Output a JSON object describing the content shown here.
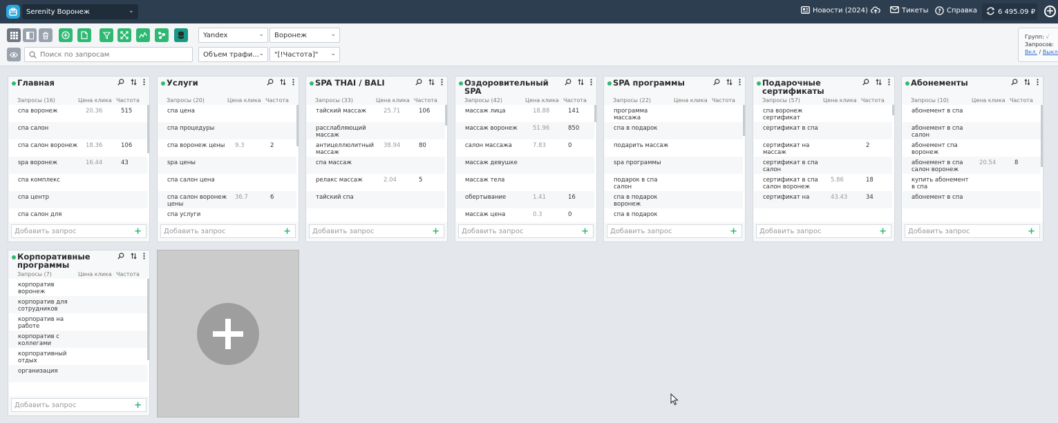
{
  "topbar": {
    "project": "Serenity Воронеж",
    "news": "Новости (2024)",
    "tickets": "Тикеты",
    "help": "Справка",
    "balance": "6 495.09 ₽"
  },
  "toolbar": {
    "search_placeholder": "Поиск по запросам",
    "engine": "Yandex",
    "region": "Воронеж",
    "traffic": "Объем трафи...",
    "frequency": "\"[!Частота]\"",
    "info_groups": "Групп: ",
    "info_queries": "Запросов: ",
    "info_on": "Вкл.",
    "info_sep": " / ",
    "info_off": "Выкл."
  },
  "columns": {
    "price": "Цена клика",
    "freq": "Частота"
  },
  "add_placeholder": "Добавить запрос",
  "groups": [
    {
      "title": "Главная",
      "count": "Запросы (16)",
      "rows": [
        {
          "q": "спа воронеж",
          "p": "20.36",
          "f": "515"
        },
        {
          "q": "спа салон",
          "p": "",
          "f": ""
        },
        {
          "q": "спа салон воронеж",
          "p": "18.36",
          "f": "106"
        },
        {
          "q": "spa воронеж",
          "p": "16.44",
          "f": "43"
        },
        {
          "q": "спа комплекс",
          "p": "",
          "f": ""
        },
        {
          "q": "спа центр",
          "p": "",
          "f": ""
        },
        {
          "q": "спа салон для",
          "p": "",
          "f": ""
        }
      ]
    },
    {
      "title": "Услуги",
      "count": "Запросы (20)",
      "rows": [
        {
          "q": "спа цена",
          "p": "",
          "f": ""
        },
        {
          "q": "спа процедуры",
          "p": "",
          "f": ""
        },
        {
          "q": "спа воронеж цены",
          "p": "9.3",
          "f": "2"
        },
        {
          "q": "spa цены",
          "p": "",
          "f": ""
        },
        {
          "q": "спа салон цена",
          "p": "",
          "f": ""
        },
        {
          "q": "спа салон воронеж цены",
          "p": "36.7",
          "f": "6"
        },
        {
          "q": "спа услуги",
          "p": "",
          "f": ""
        }
      ]
    },
    {
      "title": "SPA THAI / BALI",
      "count": "Запросы (33)",
      "rows": [
        {
          "q": "тайский массаж",
          "p": "25.71",
          "f": "106"
        },
        {
          "q": "расслабляющий массаж",
          "p": "",
          "f": ""
        },
        {
          "q": "антицеллюлитный массаж",
          "p": "38.94",
          "f": "80"
        },
        {
          "q": "спа массаж",
          "p": "",
          "f": ""
        },
        {
          "q": "релакс массаж",
          "p": "2.04",
          "f": "5"
        },
        {
          "q": "тайский спа",
          "p": "",
          "f": ""
        }
      ]
    },
    {
      "title": "Оздоровительный SPA",
      "count": "Запросы (42)",
      "rows": [
        {
          "q": "массаж лица",
          "p": "18.88",
          "f": "141"
        },
        {
          "q": "массаж воронеж",
          "p": "51.96",
          "f": "850"
        },
        {
          "q": "салон массажа",
          "p": "7.83",
          "f": "0"
        },
        {
          "q": "массаж девушке",
          "p": "",
          "f": ""
        },
        {
          "q": "массаж тела",
          "p": "",
          "f": ""
        },
        {
          "q": "обертывание",
          "p": "1.41",
          "f": "16"
        },
        {
          "q": "массаж цена",
          "p": "0.3",
          "f": "0"
        }
      ]
    },
    {
      "title": "SPA программы",
      "count": "Запросы (22)",
      "rows": [
        {
          "q": "программа массажа",
          "p": "",
          "f": ""
        },
        {
          "q": "спа в подарок",
          "p": "",
          "f": ""
        },
        {
          "q": "подарить массаж",
          "p": "",
          "f": ""
        },
        {
          "q": "spa программы",
          "p": "",
          "f": ""
        },
        {
          "q": "подарок в спа салон",
          "p": "",
          "f": ""
        },
        {
          "q": "спа в подарок воронеж",
          "p": "",
          "f": ""
        },
        {
          "q": "спа в подарок",
          "p": "",
          "f": ""
        }
      ]
    },
    {
      "title": "Подарочные сертификаты",
      "count": "Запросы (57)",
      "rows": [
        {
          "q": "спа воронеж сертификат",
          "p": "",
          "f": ""
        },
        {
          "q": "сертификат в спа",
          "p": "",
          "f": ""
        },
        {
          "q": "сертификат на массаж",
          "p": "",
          "f": "2"
        },
        {
          "q": "сертификат в спа салон",
          "p": "",
          "f": ""
        },
        {
          "q": "сертификат в спа салон воронеж",
          "p": "5.86",
          "f": "18"
        },
        {
          "q": "сертификат на",
          "p": "43.43",
          "f": "34"
        }
      ]
    },
    {
      "title": "Абонементы",
      "count": "Запросы (10)",
      "rows": [
        {
          "q": "абонемент в спа",
          "p": "",
          "f": ""
        },
        {
          "q": "абонемент в спа салон",
          "p": "",
          "f": ""
        },
        {
          "q": "абонемент спа воронеж",
          "p": "",
          "f": ""
        },
        {
          "q": "абонемент в спа салон воронеж",
          "p": "20.54",
          "f": "8"
        },
        {
          "q": "купить абонемент в спа",
          "p": "",
          "f": ""
        },
        {
          "q": "абонемент в спа",
          "p": "",
          "f": ""
        }
      ]
    },
    {
      "title": "Корпоративные программы",
      "count": "Запросы (7)",
      "rows": [
        {
          "q": "корпоратив воронеж",
          "p": "",
          "f": ""
        },
        {
          "q": "корпоратив для сотрудников",
          "p": "",
          "f": ""
        },
        {
          "q": "корпоратив на работе",
          "p": "",
          "f": ""
        },
        {
          "q": "корпоратив с коллегами",
          "p": "",
          "f": ""
        },
        {
          "q": "корпоративный отдых",
          "p": "",
          "f": ""
        },
        {
          "q": "организация",
          "p": "",
          "f": ""
        }
      ]
    }
  ]
}
